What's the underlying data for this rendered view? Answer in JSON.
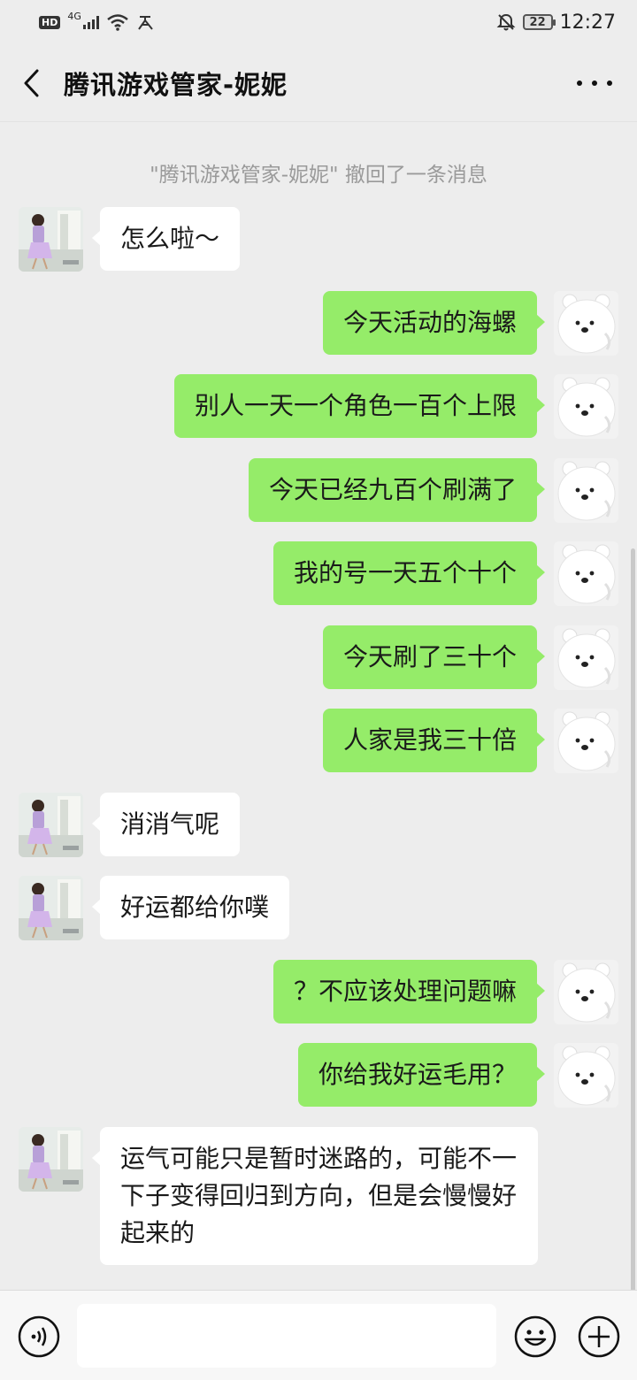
{
  "status_bar": {
    "hd": "HD",
    "network": "4G",
    "time": "12:27",
    "battery": "22"
  },
  "header": {
    "title": "腾讯游戏管家-妮妮",
    "back_icon": "chevron-left-icon",
    "more_icon": "more-dots-icon"
  },
  "chat": {
    "system_notice": "\"腾讯游戏管家-妮妮\" 撤回了一条消息",
    "messages": [
      {
        "from": "them",
        "text": "怎么啦～"
      },
      {
        "from": "me",
        "text": "今天活动的海螺"
      },
      {
        "from": "me",
        "text": "别人一天一个角色一百个上限"
      },
      {
        "from": "me",
        "text": "今天已经九百个刷满了"
      },
      {
        "from": "me",
        "text": "我的号一天五个十个"
      },
      {
        "from": "me",
        "text": "今天刷了三十个"
      },
      {
        "from": "me",
        "text": "人家是我三十倍"
      },
      {
        "from": "them",
        "text": "消消气呢"
      },
      {
        "from": "them",
        "text": "好运都给你噗"
      },
      {
        "from": "me",
        "text": "？不应该处理问题嘛"
      },
      {
        "from": "me",
        "text": "你给我好运毛用？"
      },
      {
        "from": "them",
        "text": "运气可能只是暂时迷路的，可能不一下子变得回归到方向，但是会慢慢好起来的"
      }
    ]
  },
  "input_bar": {
    "voice_icon": "voice-icon",
    "emoji_icon": "emoji-icon",
    "plus_icon": "plus-icon",
    "input_value": ""
  },
  "colors": {
    "background": "#ededed",
    "outgoing_bubble": "#95ec69",
    "incoming_bubble": "#ffffff",
    "notice_text": "#9a9a9a"
  }
}
